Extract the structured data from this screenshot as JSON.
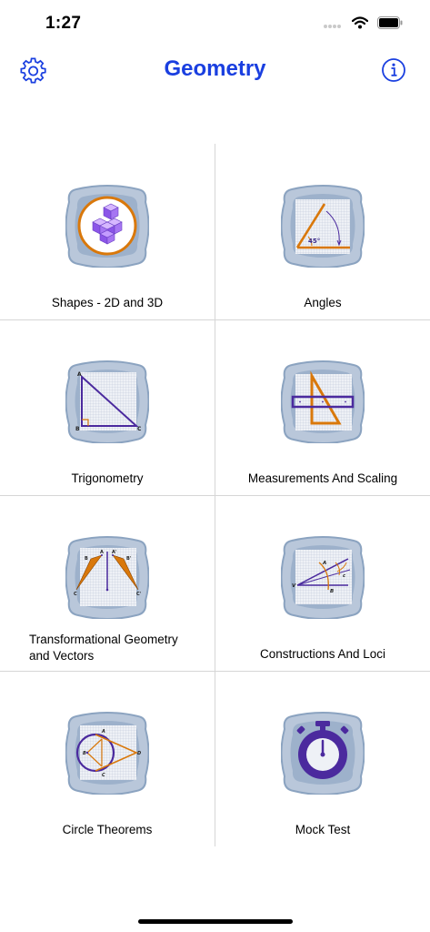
{
  "status_bar": {
    "time": "1:27"
  },
  "nav": {
    "title": "Geometry",
    "settings_icon": "gear-icon",
    "info_icon": "info-icon"
  },
  "colors": {
    "accent": "#1a3fe0",
    "tile_outer": "#b9c7da",
    "tile_inner": "#8ba3c0",
    "grid_bg": "#dfe5ee",
    "orange": "#d9780b",
    "purple": "#4b2a9e"
  },
  "topics": [
    {
      "label": "Shapes - 2D and 3D",
      "icon": "shapes-3d-icon"
    },
    {
      "label": "Angles",
      "icon": "angle-icon",
      "angle_text": "45°"
    },
    {
      "label": "Trigonometry",
      "icon": "right-triangle-icon",
      "vertices": [
        "A",
        "B",
        "C"
      ]
    },
    {
      "label": "Measurements And Scaling",
      "icon": "ruler-set-square-icon"
    },
    {
      "label": "Transformational Geometry and Vectors",
      "icon": "reflection-icon",
      "vertices": [
        "B",
        "A",
        "A'",
        "B'",
        "C",
        "C'"
      ]
    },
    {
      "label": "Constructions And Loci",
      "icon": "construction-icon",
      "vertices": [
        "A",
        "V",
        "B",
        "c"
      ]
    },
    {
      "label": "Circle Theorems",
      "icon": "circle-theorem-icon",
      "vertices": [
        "A",
        "B",
        "C",
        "D"
      ]
    },
    {
      "label": "Mock Test",
      "icon": "stopwatch-icon"
    }
  ]
}
